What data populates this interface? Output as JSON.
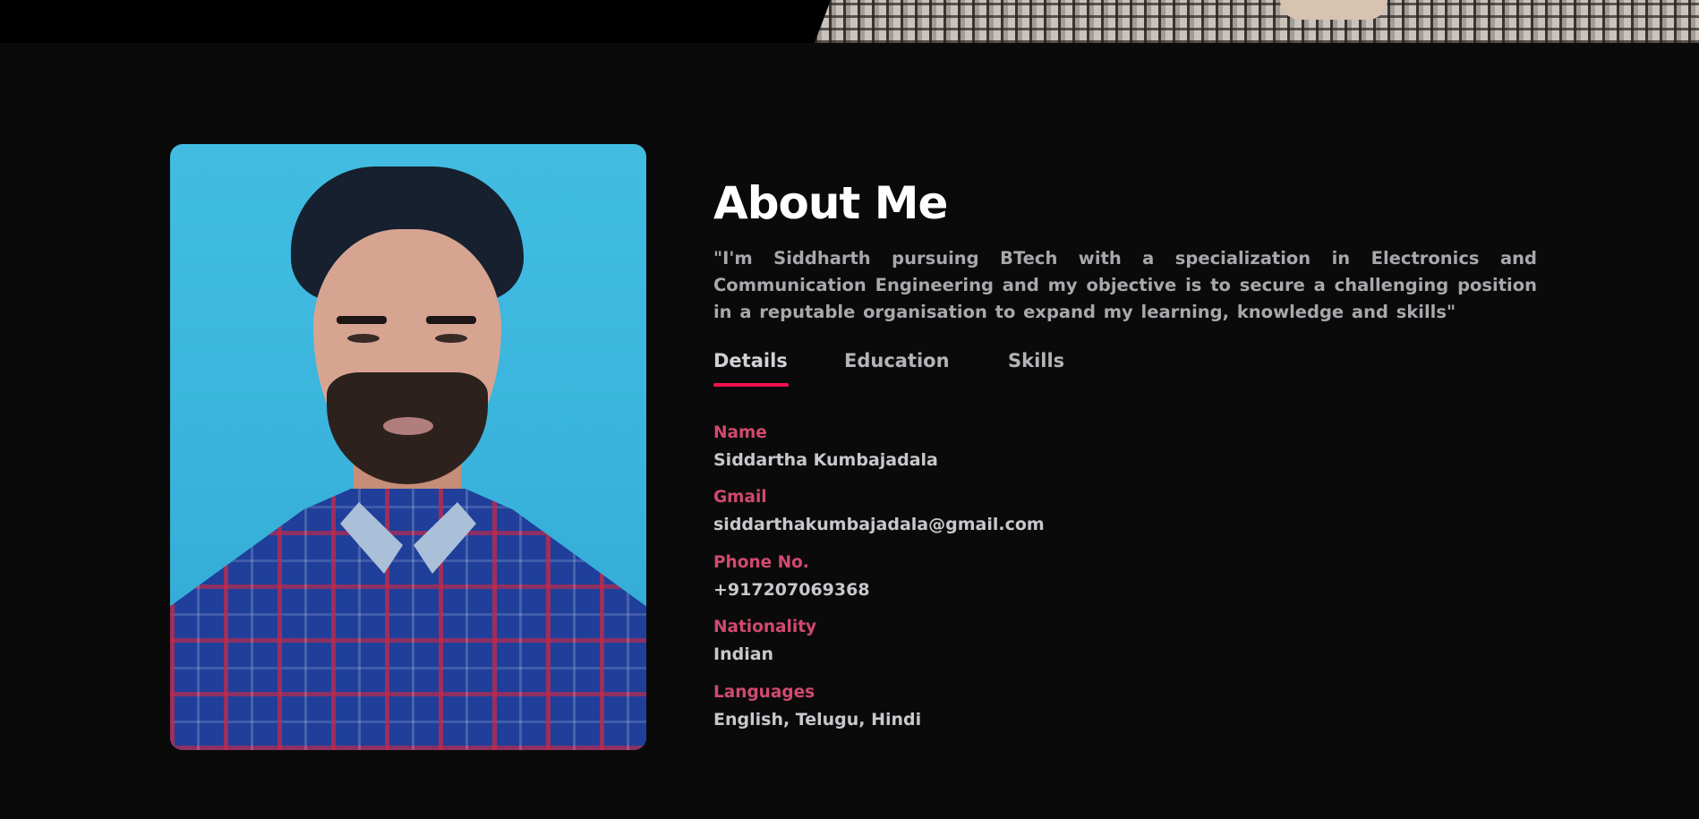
{
  "about": {
    "title": "About Me",
    "quote": "\"I'm Siddharth pursuing BTech with a specialization in Electronics and Communication Engineering and my objective is to secure a challenging position in a reputable organisation to expand my learning, knowledge and skills\""
  },
  "tabs": [
    {
      "label": "Details",
      "active": true
    },
    {
      "label": "Education",
      "active": false
    },
    {
      "label": "Skills",
      "active": false
    }
  ],
  "details": [
    {
      "label": "Name",
      "value": "Siddartha Kumbajadala"
    },
    {
      "label": "Gmail",
      "value": "siddarthakumbajadala@gmail.com"
    },
    {
      "label": "Phone No.",
      "value": "+917207069368"
    },
    {
      "label": "Nationality",
      "value": "Indian"
    },
    {
      "label": "Languages",
      "value": "English, Telugu, Hindi"
    }
  ],
  "colors": {
    "background": "#0a0a0b",
    "accent": "#ff0f4f",
    "label": "#d14a6e",
    "heading": "#ffffff",
    "body_text": "#a8a8ac"
  }
}
